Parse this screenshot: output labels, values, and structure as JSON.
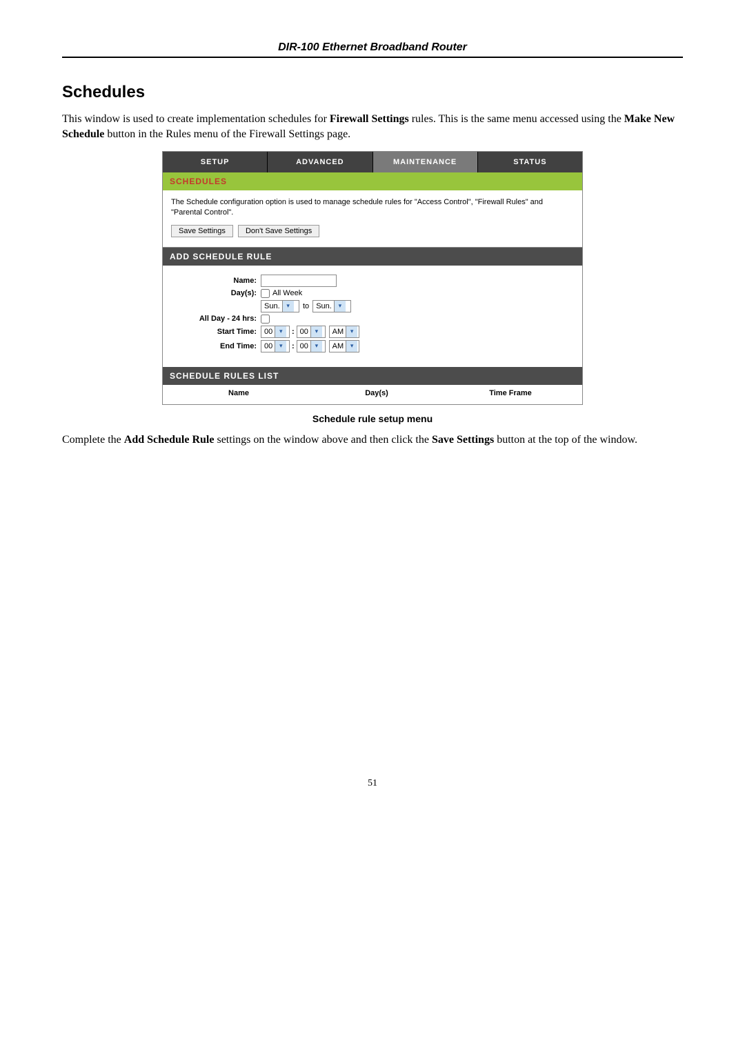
{
  "doc": {
    "header": "DIR-100 Ethernet Broadband Router",
    "section_title": "Schedules",
    "intro_part1": "This window is used to create implementation schedules for ",
    "intro_bold1": "Firewall Settings",
    "intro_part2": " rules. This is the same menu accessed using the ",
    "intro_bold2": "Make New Schedule",
    "intro_part3": " button in the Rules menu of the Firewall Settings page.",
    "caption": "Schedule rule setup menu",
    "outro_part1": "Complete the ",
    "outro_bold1": "Add Schedule Rule",
    "outro_part2": " settings on the window above and then click the ",
    "outro_bold2": "Save Settings",
    "outro_part3": " button at the top of the window.",
    "page_number": "51"
  },
  "panel": {
    "tabs": {
      "setup": "SETUP",
      "advanced": "ADVANCED",
      "maintenance": "MAINTENANCE",
      "status": "STATUS"
    },
    "green_title": "SCHEDULES",
    "desc": "The Schedule configuration option is used to manage schedule rules for \"Access Control\", \"Firewall Rules\" and \"Parental Control\".",
    "save_btn": "Save Settings",
    "dont_save_btn": "Don't Save Settings",
    "add_header": "ADD SCHEDULE RULE",
    "labels": {
      "name": "Name:",
      "days": "Day(s):",
      "all_week": "All Week",
      "to": "to",
      "all_day": "All Day - 24 hrs:",
      "start_time": "Start Time:",
      "end_time": "End Time:"
    },
    "values": {
      "day_from": "Sun.",
      "day_to": "Sun.",
      "h1": "00",
      "m1": "00",
      "ap1": "AM",
      "h2": "00",
      "m2": "00",
      "ap2": "AM"
    },
    "list_header": "SCHEDULE RULES LIST",
    "list_cols": {
      "name": "Name",
      "days": "Day(s)",
      "timeframe": "Time Frame"
    }
  }
}
